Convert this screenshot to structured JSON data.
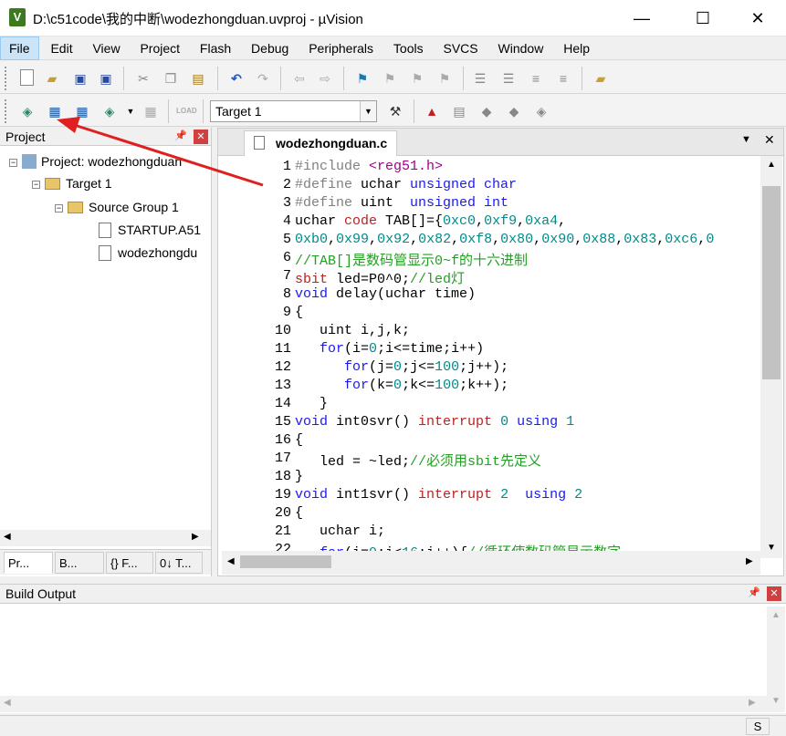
{
  "window": {
    "title": "D:\\c51code\\我的中断\\wodezhongduan.uvproj - µVision",
    "app_icon": "V",
    "minimize": "—",
    "maximize": "☐",
    "close": "✕"
  },
  "menu": [
    "File",
    "Edit",
    "View",
    "Project",
    "Flash",
    "Debug",
    "Peripherals",
    "Tools",
    "SVCS",
    "Window",
    "Help"
  ],
  "toolbar2": {
    "target_select": "Target 1"
  },
  "project_panel": {
    "title": "Project",
    "tree": [
      {
        "label": "Project: wodezhongduan",
        "icon": "project-icon"
      },
      {
        "label": "Target 1",
        "icon": "target-icon"
      },
      {
        "label": "Source Group 1",
        "icon": "folder-icon"
      },
      {
        "label": "STARTUP.A51",
        "icon": "file-icon"
      },
      {
        "label": "wodezhongdu",
        "icon": "file-icon"
      }
    ],
    "tabs": [
      "Pr...",
      "B...",
      "{} F...",
      "0↓ T..."
    ]
  },
  "editor": {
    "tab_label": "wodezhongduan.c",
    "line_numbers": [
      "1",
      "2",
      "3",
      "4",
      "5",
      "6",
      "7",
      "8",
      "9",
      "10",
      "11",
      "12",
      "13",
      "14",
      "15",
      "16",
      "17",
      "18",
      "19",
      "20",
      "21",
      "22"
    ]
  },
  "build_output": {
    "title": "Build Output"
  },
  "status": {
    "mode": "S"
  },
  "colors": {
    "keyword": "#1a1af0",
    "comment": "#22a022",
    "number": "#008a8a",
    "annotation_arrow": "#e02020"
  }
}
